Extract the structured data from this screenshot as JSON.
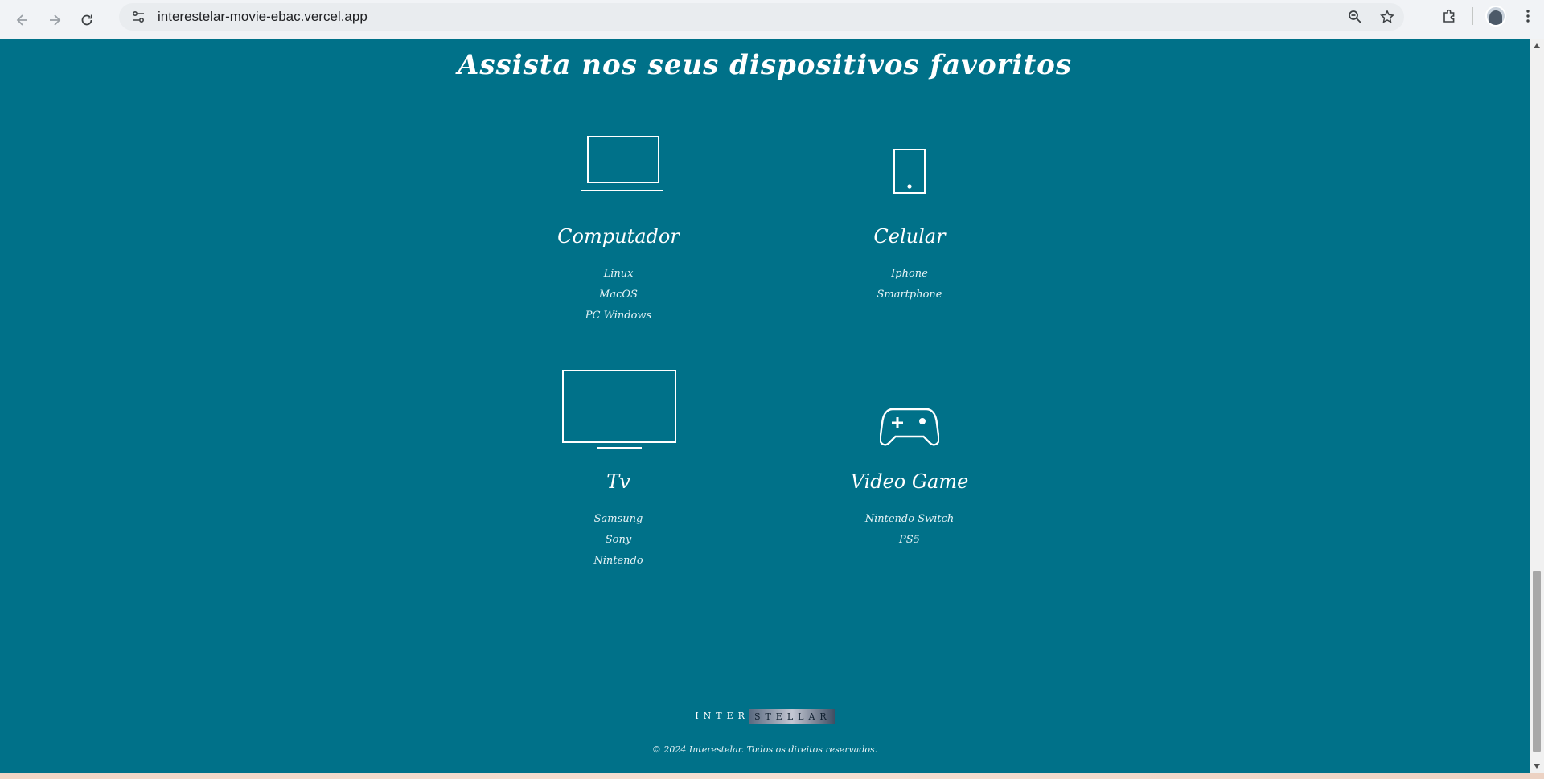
{
  "browser": {
    "url": "interestelar-movie-ebac.vercel.app",
    "icons": {
      "back": "arrow-left-icon",
      "forward": "arrow-right-icon",
      "reload": "reload-icon",
      "site_info": "tune-icon",
      "zoom": "zoom-icon",
      "bookmark": "star-icon",
      "extensions": "puzzle-icon",
      "profile": "avatar",
      "menu": "kebab-menu-icon"
    }
  },
  "page": {
    "heading": "Assista nos seus dispositivos favoritos",
    "background_color": "#007189",
    "devices": [
      {
        "icon": "laptop-icon",
        "title": "Computador",
        "items": [
          "Linux",
          "MacOS",
          "PC Windows"
        ]
      },
      {
        "icon": "phone-icon",
        "title": "Celular",
        "items": [
          "Iphone",
          "Smartphone"
        ]
      },
      {
        "icon": "tv-icon",
        "title": "Tv",
        "items": [
          "Samsung",
          "Sony",
          "Nintendo"
        ]
      },
      {
        "icon": "gamepad-icon",
        "title": "Video Game",
        "items": [
          "Nintendo Switch",
          "PS5"
        ]
      }
    ],
    "footer": {
      "logo_left": "INTER",
      "logo_right": "STELLAR",
      "copyright": "© 2024 Interestelar. Todos os direitos reservados."
    }
  }
}
